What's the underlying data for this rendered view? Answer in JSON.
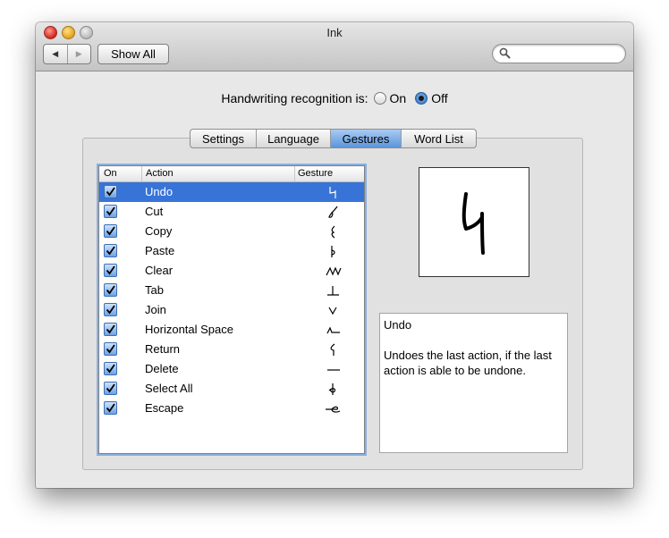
{
  "window": {
    "title": "Ink"
  },
  "toolbar": {
    "show_all_label": "Show All",
    "search_placeholder": "",
    "back_glyph": "◀",
    "forward_glyph": "▶"
  },
  "recognition": {
    "label": "Handwriting recognition is:",
    "on_label": "On",
    "off_label": "Off",
    "selected": "Off"
  },
  "tabs": [
    {
      "label": "Settings",
      "selected": false
    },
    {
      "label": "Language",
      "selected": false
    },
    {
      "label": "Gestures",
      "selected": true
    },
    {
      "label": "Word List",
      "selected": false
    }
  ],
  "gesture_table": {
    "headers": {
      "on": "On",
      "action": "Action",
      "gesture": "Gesture"
    },
    "rows": [
      {
        "action": "Undo",
        "checked": true,
        "selected": true,
        "gesture_icon": "undo-gesture-icon"
      },
      {
        "action": "Cut",
        "checked": true,
        "selected": false,
        "gesture_icon": "cut-gesture-icon"
      },
      {
        "action": "Copy",
        "checked": true,
        "selected": false,
        "gesture_icon": "copy-gesture-icon"
      },
      {
        "action": "Paste",
        "checked": true,
        "selected": false,
        "gesture_icon": "paste-gesture-icon"
      },
      {
        "action": "Clear",
        "checked": true,
        "selected": false,
        "gesture_icon": "clear-gesture-icon"
      },
      {
        "action": "Tab",
        "checked": true,
        "selected": false,
        "gesture_icon": "tab-gesture-icon"
      },
      {
        "action": "Join",
        "checked": true,
        "selected": false,
        "gesture_icon": "join-gesture-icon"
      },
      {
        "action": "Horizontal Space",
        "checked": true,
        "selected": false,
        "gesture_icon": "horizontal-space-gesture-icon"
      },
      {
        "action": "Return",
        "checked": true,
        "selected": false,
        "gesture_icon": "return-gesture-icon"
      },
      {
        "action": "Delete",
        "checked": true,
        "selected": false,
        "gesture_icon": "delete-gesture-icon"
      },
      {
        "action": "Select All",
        "checked": true,
        "selected": false,
        "gesture_icon": "select-all-gesture-icon"
      },
      {
        "action": "Escape",
        "checked": true,
        "selected": false,
        "gesture_icon": "escape-gesture-icon"
      }
    ]
  },
  "description": {
    "title": "Undo",
    "text": "Undoes the last action, if the last action is able to be undone."
  },
  "colors": {
    "selection": "#3874d8",
    "tab_selected": "#5b95dc"
  }
}
